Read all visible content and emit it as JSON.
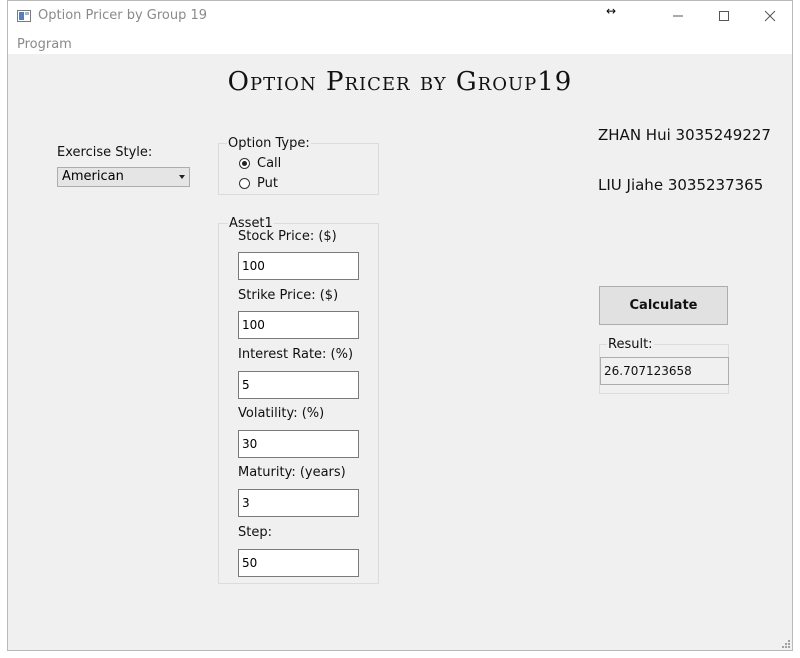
{
  "window": {
    "title": "Option Pricer by Group 19",
    "controls": {
      "minimize": "minimize-icon",
      "maximize": "maximize-icon",
      "close": "close-icon"
    }
  },
  "menu": {
    "items": [
      "Program"
    ]
  },
  "heading": "Option Pricer by Group19",
  "exercise_style": {
    "label": "Exercise Style:",
    "selected": "American"
  },
  "option_type": {
    "title": "Option Type:",
    "options": [
      {
        "label": "Call",
        "checked": true
      },
      {
        "label": "Put",
        "checked": false
      }
    ]
  },
  "asset": {
    "title": "Asset1",
    "fields": [
      {
        "label": "Stock Price: ($)",
        "value": "100"
      },
      {
        "label": "Strike Price: ($)",
        "value": "100"
      },
      {
        "label": "Interest Rate: (%)",
        "value": "5"
      },
      {
        "label": "Volatility: (%)",
        "value": "30"
      },
      {
        "label": "Maturity: (years)",
        "value": "3"
      },
      {
        "label": "Step:",
        "value": "50"
      }
    ]
  },
  "authors": [
    "ZHAN Hui 3035249227",
    "LIU Jiahe 3035237365"
  ],
  "calculate_label": "Calculate",
  "result": {
    "title": "Result:",
    "value": "26.707123658"
  }
}
